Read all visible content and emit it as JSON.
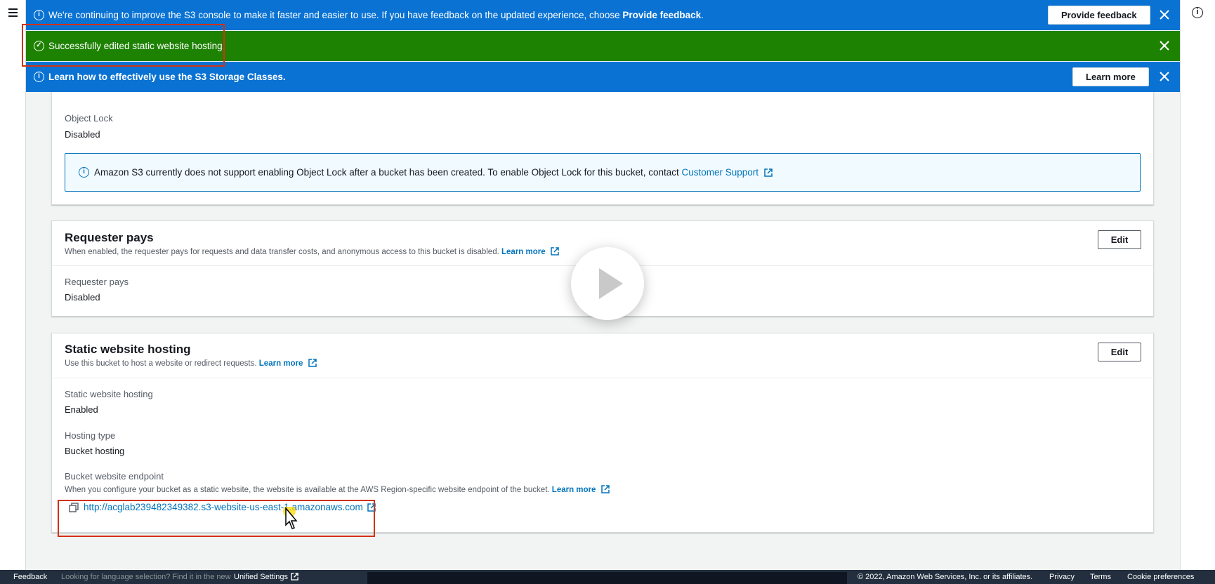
{
  "flash": {
    "feedback": {
      "text": "We're continuing to improve the S3 console to make it faster and easier to use. If you have feedback on the updated experience, choose ",
      "bold": "Provide feedback",
      "end": ".",
      "button": "Provide feedback"
    },
    "success": {
      "text": "Successfully edited static website hosting."
    },
    "storage": {
      "text": "Learn how to effectively use the S3 Storage Classes.",
      "button": "Learn more"
    }
  },
  "object_lock": {
    "label": "Object Lock",
    "value": "Disabled",
    "alert_text": "Amazon S3 currently does not support enabling Object Lock after a bucket has been created. To enable Object Lock for this bucket, contact ",
    "alert_link": "Customer Support"
  },
  "requester_pays": {
    "title": "Requester pays",
    "description": "When enabled, the requester pays for requests and data transfer costs, and anonymous access to this bucket is disabled.",
    "learn_more": "Learn more",
    "edit": "Edit",
    "label": "Requester pays",
    "value": "Disabled"
  },
  "static_hosting": {
    "title": "Static website hosting",
    "description": "Use this bucket to host a website or redirect requests.",
    "learn_more": "Learn more",
    "edit": "Edit",
    "hosting_label": "Static website hosting",
    "hosting_value": "Enabled",
    "type_label": "Hosting type",
    "type_value": "Bucket hosting",
    "endpoint_label": "Bucket website endpoint",
    "endpoint_desc": "When you configure your bucket as a static website, the website is available at the AWS Region-specific website endpoint of the bucket.",
    "endpoint_learn_more": "Learn more",
    "endpoint_url": "http://acglab239482349382.s3-website-us-east-1.amazonaws.com"
  },
  "footer": {
    "feedback": "Feedback",
    "language_text": "Looking for language selection? Find it in the new",
    "unified_settings": "Unified Settings",
    "copyright": "© 2022, Amazon Web Services, Inc. or its affiliates.",
    "privacy": "Privacy",
    "terms": "Terms",
    "cookie": "Cookie preferences"
  },
  "colors": {
    "flash_blue": "#0972d3",
    "flash_green": "#1d8102",
    "link": "#0073bb",
    "highlight": "#d13212"
  }
}
